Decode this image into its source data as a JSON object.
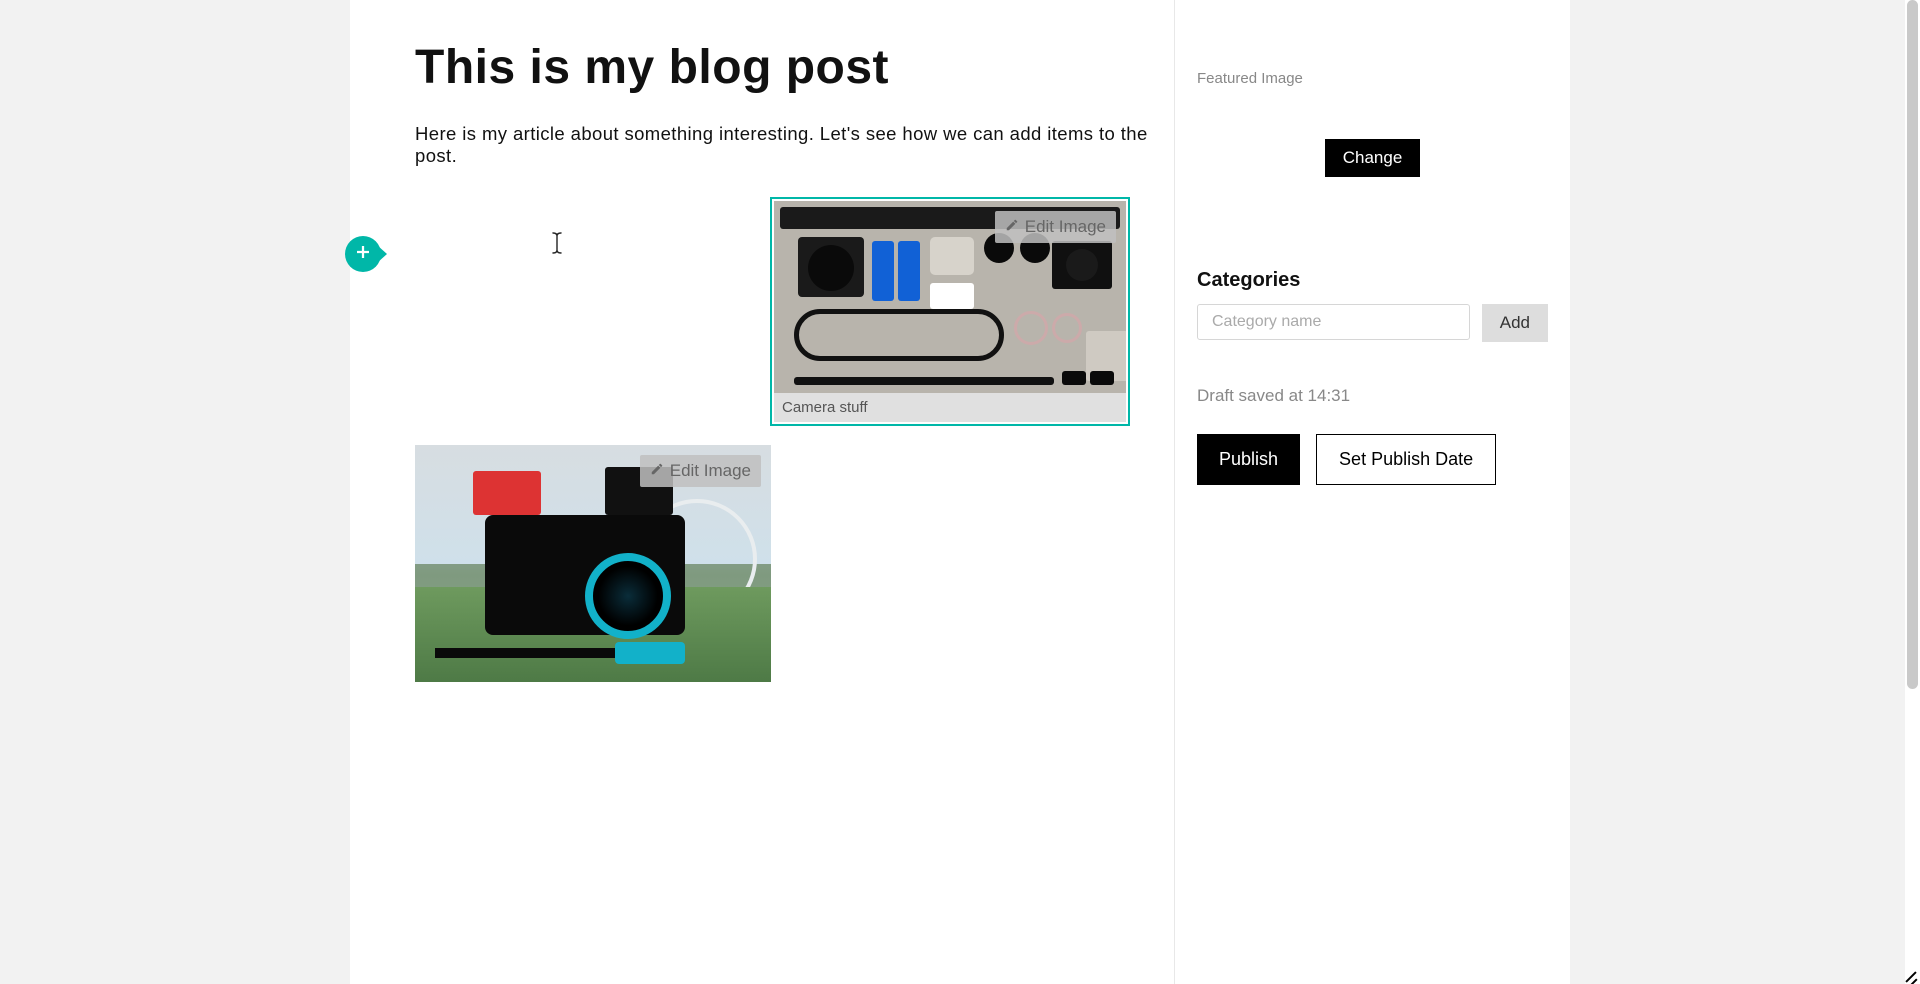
{
  "post": {
    "title": "This is my blog post",
    "body": "Here is my article about something interesting. Let's see how we can add items to the post."
  },
  "images": {
    "edit_label": "Edit Image",
    "block1_caption": "Camera stuff"
  },
  "sidebar": {
    "featured_label": "Featured Image",
    "change_button": "Change",
    "categories_heading": "Categories",
    "category_placeholder": "Category name",
    "add_button": "Add",
    "draft_status": "Draft saved at 14:31",
    "publish_button": "Publish",
    "set_date_button": "Set Publish Date"
  }
}
